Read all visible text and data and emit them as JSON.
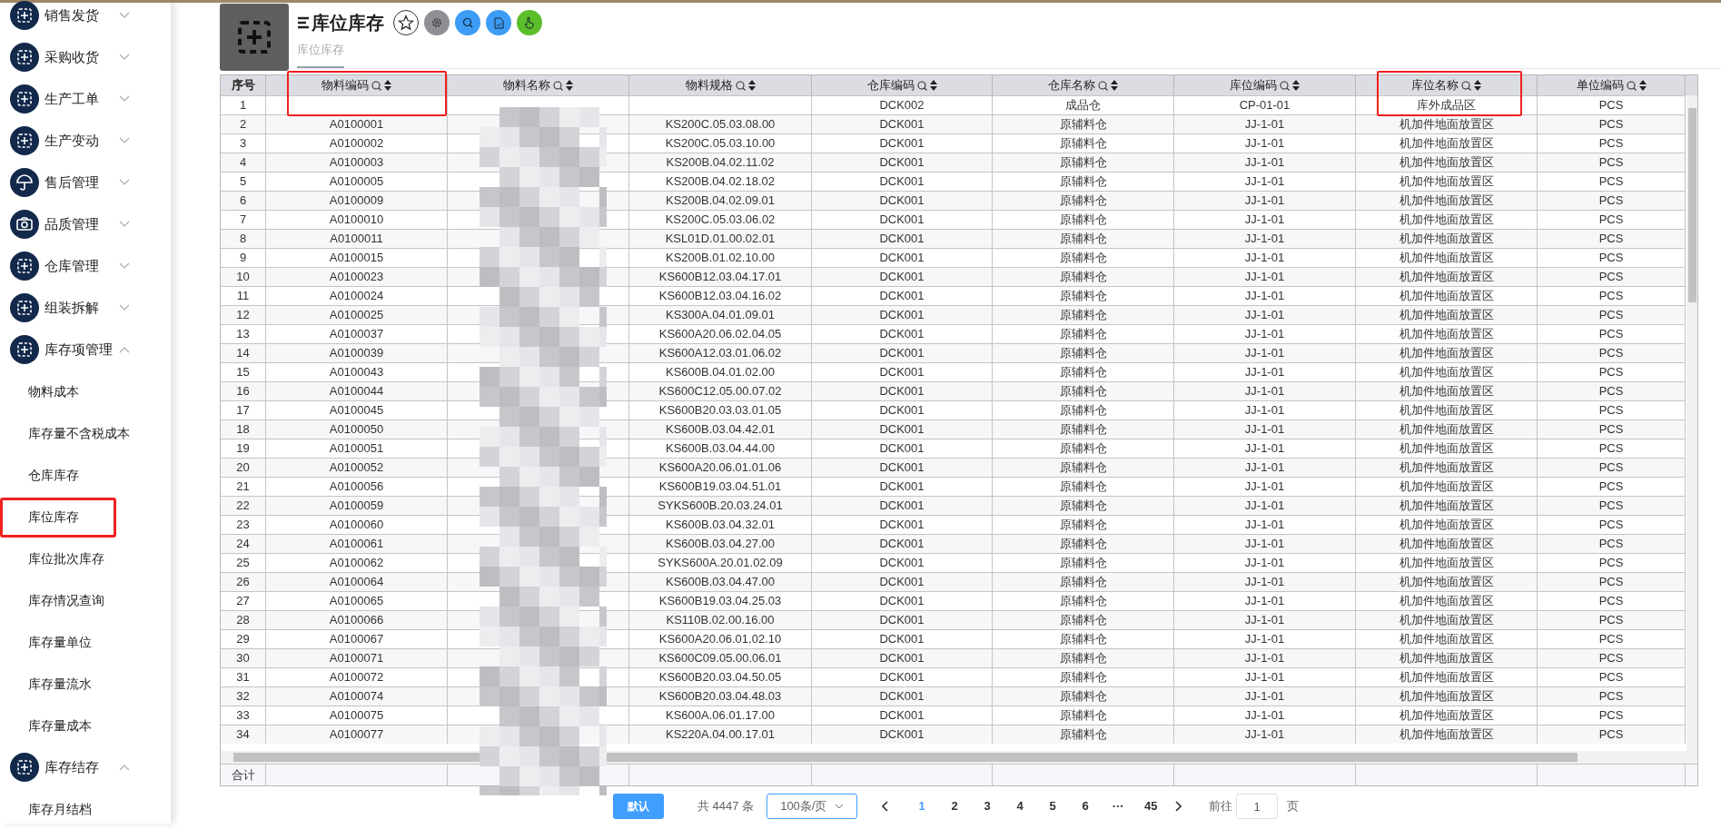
{
  "sidebar": {
    "groups": [
      {
        "label": "销售发货",
        "expanded": false
      },
      {
        "label": "采购收货",
        "expanded": false
      },
      {
        "label": "生产工单",
        "expanded": false
      },
      {
        "label": "生产变动",
        "expanded": false
      },
      {
        "label": "售后管理",
        "expanded": false
      },
      {
        "label": "品质管理",
        "expanded": false
      },
      {
        "label": "仓库管理",
        "expanded": false
      },
      {
        "label": "组装拆解",
        "expanded": false
      },
      {
        "label": "库存项管理",
        "expanded": true,
        "children": [
          {
            "label": "物料成本",
            "highlighted": false
          },
          {
            "label": "库存量不含税成本",
            "highlighted": false
          },
          {
            "label": "仓库库存",
            "highlighted": false
          },
          {
            "label": "库位库存",
            "highlighted": true
          },
          {
            "label": "库位批次库存",
            "highlighted": false
          },
          {
            "label": "库存情况查询",
            "highlighted": false
          },
          {
            "label": "库存量单位",
            "highlighted": false
          },
          {
            "label": "库存量流水",
            "highlighted": false
          },
          {
            "label": "库存量成本",
            "highlighted": false
          }
        ]
      },
      {
        "label": "库存结存",
        "expanded": true,
        "children": [
          {
            "label": "库存月结档",
            "highlighted": false
          }
        ]
      }
    ]
  },
  "page": {
    "title": "库位库存",
    "tabs": [
      {
        "label": "库位库存",
        "selected": true
      }
    ]
  },
  "table": {
    "columns": [
      {
        "label": "序号",
        "filterable": false,
        "highlighted": false
      },
      {
        "label": "物料编码",
        "filterable": true,
        "highlighted": true
      },
      {
        "label": "物料名称",
        "filterable": true,
        "highlighted": false
      },
      {
        "label": "物料规格",
        "filterable": true,
        "highlighted": false
      },
      {
        "label": "仓库编码",
        "filterable": true,
        "highlighted": false
      },
      {
        "label": "仓库名称",
        "filterable": true,
        "highlighted": false
      },
      {
        "label": "库位编码",
        "filterable": true,
        "highlighted": false
      },
      {
        "label": "库位名称",
        "filterable": true,
        "highlighted": true
      },
      {
        "label": "单位编码",
        "filterable": true,
        "highlighted": false
      }
    ],
    "rows": [
      {
        "no": "1",
        "warehouse_code": "DCK002",
        "warehouse_name": "成品仓",
        "location_code": "CP-01-01",
        "location_name": "库外成品区",
        "unit": "PCS"
      },
      {
        "no": "2",
        "material_code": "A0100001",
        "spec": "KS200C.05.03.08.00",
        "warehouse_code": "DCK001",
        "warehouse_name": "原辅料仓",
        "location_code": "JJ-1-01",
        "location_name": "机加件地面放置区",
        "unit": "PCS"
      },
      {
        "no": "3",
        "material_code": "A0100002",
        "spec": "KS200C.05.03.10.00",
        "warehouse_code": "DCK001",
        "warehouse_name": "原辅料仓",
        "location_code": "JJ-1-01",
        "location_name": "机加件地面放置区",
        "unit": "PCS"
      },
      {
        "no": "4",
        "material_code": "A0100003",
        "spec": "KS200B.04.02.11.02",
        "warehouse_code": "DCK001",
        "warehouse_name": "原辅料仓",
        "location_code": "JJ-1-01",
        "location_name": "机加件地面放置区",
        "unit": "PCS"
      },
      {
        "no": "5",
        "material_code": "A0100005",
        "spec": "KS200B.04.02.18.02",
        "warehouse_code": "DCK001",
        "warehouse_name": "原辅料仓",
        "location_code": "JJ-1-01",
        "location_name": "机加件地面放置区",
        "unit": "PCS"
      },
      {
        "no": "6",
        "material_code": "A0100009",
        "spec": "KS200B.04.02.09.01",
        "warehouse_code": "DCK001",
        "warehouse_name": "原辅料仓",
        "location_code": "JJ-1-01",
        "location_name": "机加件地面放置区",
        "unit": "PCS"
      },
      {
        "no": "7",
        "material_code": "A0100010",
        "spec": "KS200C.05.03.06.02",
        "warehouse_code": "DCK001",
        "warehouse_name": "原辅料仓",
        "location_code": "JJ-1-01",
        "location_name": "机加件地面放置区",
        "unit": "PCS"
      },
      {
        "no": "8",
        "material_code": "A0100011",
        "spec": "KSL01D.01.00.02.01",
        "warehouse_code": "DCK001",
        "warehouse_name": "原辅料仓",
        "location_code": "JJ-1-01",
        "location_name": "机加件地面放置区",
        "unit": "PCS"
      },
      {
        "no": "9",
        "material_code": "A0100015",
        "spec": "KS200B.01.02.10.00",
        "warehouse_code": "DCK001",
        "warehouse_name": "原辅料仓",
        "location_code": "JJ-1-01",
        "location_name": "机加件地面放置区",
        "unit": "PCS"
      },
      {
        "no": "10",
        "material_code": "A0100023",
        "spec": "KS600B12.03.04.17.01",
        "warehouse_code": "DCK001",
        "warehouse_name": "原辅料仓",
        "location_code": "JJ-1-01",
        "location_name": "机加件地面放置区",
        "unit": "PCS"
      },
      {
        "no": "11",
        "material_code": "A0100024",
        "spec": "KS600B12.03.04.16.02",
        "warehouse_code": "DCK001",
        "warehouse_name": "原辅料仓",
        "location_code": "JJ-1-01",
        "location_name": "机加件地面放置区",
        "unit": "PCS"
      },
      {
        "no": "12",
        "material_code": "A0100025",
        "spec": "KS300A.04.01.09.01",
        "warehouse_code": "DCK001",
        "warehouse_name": "原辅料仓",
        "location_code": "JJ-1-01",
        "location_name": "机加件地面放置区",
        "unit": "PCS"
      },
      {
        "no": "13",
        "material_code": "A0100037",
        "spec": "KS600A20.06.02.04.05",
        "warehouse_code": "DCK001",
        "warehouse_name": "原辅料仓",
        "location_code": "JJ-1-01",
        "location_name": "机加件地面放置区",
        "unit": "PCS"
      },
      {
        "no": "14",
        "material_code": "A0100039",
        "spec": "KS600A12.03.01.06.02",
        "warehouse_code": "DCK001",
        "warehouse_name": "原辅料仓",
        "location_code": "JJ-1-01",
        "location_name": "机加件地面放置区",
        "unit": "PCS"
      },
      {
        "no": "15",
        "material_code": "A0100043",
        "spec": "KS600B.04.01.02.00",
        "warehouse_code": "DCK001",
        "warehouse_name": "原辅料仓",
        "location_code": "JJ-1-01",
        "location_name": "机加件地面放置区",
        "unit": "PCS"
      },
      {
        "no": "16",
        "material_code": "A0100044",
        "spec": "KS600C12.05.00.07.02",
        "warehouse_code": "DCK001",
        "warehouse_name": "原辅料仓",
        "location_code": "JJ-1-01",
        "location_name": "机加件地面放置区",
        "unit": "PCS"
      },
      {
        "no": "17",
        "material_code": "A0100045",
        "spec": "KS600B20.03.03.01.05",
        "warehouse_code": "DCK001",
        "warehouse_name": "原辅料仓",
        "location_code": "JJ-1-01",
        "location_name": "机加件地面放置区",
        "unit": "PCS"
      },
      {
        "no": "18",
        "material_code": "A0100050",
        "spec": "KS600B.03.04.42.01",
        "warehouse_code": "DCK001",
        "warehouse_name": "原辅料仓",
        "location_code": "JJ-1-01",
        "location_name": "机加件地面放置区",
        "unit": "PCS"
      },
      {
        "no": "19",
        "material_code": "A0100051",
        "spec": "KS600B.03.04.44.00",
        "warehouse_code": "DCK001",
        "warehouse_name": "原辅料仓",
        "location_code": "JJ-1-01",
        "location_name": "机加件地面放置区",
        "unit": "PCS"
      },
      {
        "no": "20",
        "material_code": "A0100052",
        "spec": "KS600A20.06.01.01.06",
        "warehouse_code": "DCK001",
        "warehouse_name": "原辅料仓",
        "location_code": "JJ-1-01",
        "location_name": "机加件地面放置区",
        "unit": "PCS"
      },
      {
        "no": "21",
        "material_code": "A0100056",
        "spec": "KS600B19.03.04.51.01",
        "warehouse_code": "DCK001",
        "warehouse_name": "原辅料仓",
        "location_code": "JJ-1-01",
        "location_name": "机加件地面放置区",
        "unit": "PCS"
      },
      {
        "no": "22",
        "material_code": "A0100059",
        "spec": "SYKS600B.20.03.24.01",
        "warehouse_code": "DCK001",
        "warehouse_name": "原辅料仓",
        "location_code": "JJ-1-01",
        "location_name": "机加件地面放置区",
        "unit": "PCS"
      },
      {
        "no": "23",
        "material_code": "A0100060",
        "spec": "KS600B.03.04.32.01",
        "warehouse_code": "DCK001",
        "warehouse_name": "原辅料仓",
        "location_code": "JJ-1-01",
        "location_name": "机加件地面放置区",
        "unit": "PCS"
      },
      {
        "no": "24",
        "material_code": "A0100061",
        "spec": "KS600B.03.04.27.00",
        "warehouse_code": "DCK001",
        "warehouse_name": "原辅料仓",
        "location_code": "JJ-1-01",
        "location_name": "机加件地面放置区",
        "unit": "PCS"
      },
      {
        "no": "25",
        "material_code": "A0100062",
        "spec": "SYKS600A.20.01.02.09",
        "warehouse_code": "DCK001",
        "warehouse_name": "原辅料仓",
        "location_code": "JJ-1-01",
        "location_name": "机加件地面放置区",
        "unit": "PCS"
      },
      {
        "no": "26",
        "material_code": "A0100064",
        "spec": "KS600B.03.04.47.00",
        "warehouse_code": "DCK001",
        "warehouse_name": "原辅料仓",
        "location_code": "JJ-1-01",
        "location_name": "机加件地面放置区",
        "unit": "PCS"
      },
      {
        "no": "27",
        "material_code": "A0100065",
        "spec": "KS600B19.03.04.25.03",
        "warehouse_code": "DCK001",
        "warehouse_name": "原辅料仓",
        "location_code": "JJ-1-01",
        "location_name": "机加件地面放置区",
        "unit": "PCS"
      },
      {
        "no": "28",
        "material_code": "A0100066",
        "spec": "KS110B.02.00.16.00",
        "warehouse_code": "DCK001",
        "warehouse_name": "原辅料仓",
        "location_code": "JJ-1-01",
        "location_name": "机加件地面放置区",
        "unit": "PCS"
      },
      {
        "no": "29",
        "material_code": "A0100067",
        "spec": "KS600A20.06.01.02.10",
        "warehouse_code": "DCK001",
        "warehouse_name": "原辅料仓",
        "location_code": "JJ-1-01",
        "location_name": "机加件地面放置区",
        "unit": "PCS"
      },
      {
        "no": "30",
        "material_code": "A0100071",
        "spec": "KS600C09.05.00.06.01",
        "warehouse_code": "DCK001",
        "warehouse_name": "原辅料仓",
        "location_code": "JJ-1-01",
        "location_name": "机加件地面放置区",
        "unit": "PCS"
      },
      {
        "no": "31",
        "material_code": "A0100072",
        "spec": "KS600B20.03.04.50.05",
        "warehouse_code": "DCK001",
        "warehouse_name": "原辅料仓",
        "location_code": "JJ-1-01",
        "location_name": "机加件地面放置区",
        "unit": "PCS"
      },
      {
        "no": "32",
        "material_code": "A0100074",
        "spec": "KS600B20.03.04.48.03",
        "warehouse_code": "DCK001",
        "warehouse_name": "原辅料仓",
        "location_code": "JJ-1-01",
        "location_name": "机加件地面放置区",
        "unit": "PCS"
      },
      {
        "no": "33",
        "material_code": "A0100075",
        "spec": "KS600A.06.01.17.00",
        "warehouse_code": "DCK001",
        "warehouse_name": "原辅料仓",
        "location_code": "JJ-1-01",
        "location_name": "机加件地面放置区",
        "unit": "PCS"
      },
      {
        "no": "34",
        "material_code": "A0100077",
        "spec": "KS220A.04.00.17.01",
        "warehouse_code": "DCK001",
        "warehouse_name": "原辅料仓",
        "location_code": "JJ-1-01",
        "location_name": "机加件地面放置区",
        "unit": "PCS"
      }
    ],
    "footer_label": "合计"
  },
  "pagination": {
    "default_button": "默认",
    "total": "共 4447 条",
    "page_size": "100条/页",
    "pages": [
      {
        "label": "1",
        "selected": true
      },
      {
        "label": "2",
        "selected": false
      },
      {
        "label": "3",
        "selected": false
      },
      {
        "label": "4",
        "selected": false
      },
      {
        "label": "5",
        "selected": false
      },
      {
        "label": "6",
        "selected": false
      },
      {
        "label": "···",
        "selected": false
      },
      {
        "label": "45",
        "selected": false
      }
    ],
    "goto_label": "前往",
    "goto_value": "1",
    "goto_suffix": "页"
  }
}
